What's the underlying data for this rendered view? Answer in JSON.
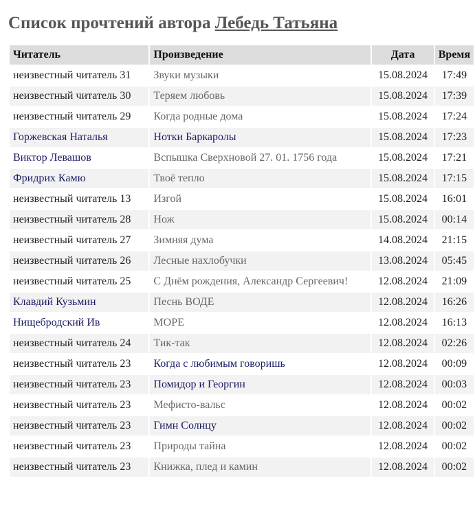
{
  "header": {
    "title_prefix": "Список прочтений автора",
    "author_name": "Лебедь Татьяна"
  },
  "table": {
    "columns": {
      "reader": "Читатель",
      "work": "Произведение",
      "date": "Дата",
      "time": "Время"
    },
    "rows": [
      {
        "reader": "неизвестный читатель 31",
        "reader_link": false,
        "work": "Звуки музыки",
        "work_link": false,
        "date": "15.08.2024",
        "time": "17:49"
      },
      {
        "reader": "неизвестный читатель 30",
        "reader_link": false,
        "work": "Теряем любовь",
        "work_link": false,
        "date": "15.08.2024",
        "time": "17:39"
      },
      {
        "reader": "неизвестный читатель 29",
        "reader_link": false,
        "work": "Когда родные дома",
        "work_link": false,
        "date": "15.08.2024",
        "time": "17:24"
      },
      {
        "reader": "Горжевская Наталья",
        "reader_link": true,
        "work": "Нотки Баркаролы",
        "work_link": true,
        "date": "15.08.2024",
        "time": "17:23"
      },
      {
        "reader": "Виктор Левашов",
        "reader_link": true,
        "work": "Вспышка Сверхновой 27. 01. 1756 года",
        "work_link": false,
        "date": "15.08.2024",
        "time": "17:21"
      },
      {
        "reader": "Фридрих Камю",
        "reader_link": true,
        "work": "Твоё тепло",
        "work_link": false,
        "date": "15.08.2024",
        "time": "17:15"
      },
      {
        "reader": "неизвестный читатель 13",
        "reader_link": false,
        "work": "Изгой",
        "work_link": false,
        "date": "15.08.2024",
        "time": "16:01"
      },
      {
        "reader": "неизвестный читатель 28",
        "reader_link": false,
        "work": "Нож",
        "work_link": false,
        "date": "15.08.2024",
        "time": "00:14"
      },
      {
        "reader": "неизвестный читатель 27",
        "reader_link": false,
        "work": "Зимняя дума",
        "work_link": false,
        "date": "14.08.2024",
        "time": "21:15"
      },
      {
        "reader": "неизвестный читатель 26",
        "reader_link": false,
        "work": "Лесные нахлобучки",
        "work_link": false,
        "date": "13.08.2024",
        "time": "05:45"
      },
      {
        "reader": "неизвестный читатель 25",
        "reader_link": false,
        "work": "С Днём рождения, Александр Сергеевич!",
        "work_link": false,
        "date": "12.08.2024",
        "time": "21:09"
      },
      {
        "reader": "Клавдий Кузьмин",
        "reader_link": true,
        "work": "Песнь ВОДЕ",
        "work_link": false,
        "date": "12.08.2024",
        "time": "16:26"
      },
      {
        "reader": "Нищебродский Ив",
        "reader_link": true,
        "work": "МОРЕ",
        "work_link": false,
        "date": "12.08.2024",
        "time": "16:13"
      },
      {
        "reader": "неизвестный читатель 24",
        "reader_link": false,
        "work": "Тик-так",
        "work_link": false,
        "date": "12.08.2024",
        "time": "02:26"
      },
      {
        "reader": "неизвестный читатель 23",
        "reader_link": false,
        "work": "Когда с любимым говоришь",
        "work_link": true,
        "date": "12.08.2024",
        "time": "00:09"
      },
      {
        "reader": "неизвестный читатель 23",
        "reader_link": false,
        "work": "Помидор и Георгин",
        "work_link": true,
        "date": "12.08.2024",
        "time": "00:03"
      },
      {
        "reader": "неизвестный читатель 23",
        "reader_link": false,
        "work": "Мефисто-вальс",
        "work_link": false,
        "date": "12.08.2024",
        "time": "00:02"
      },
      {
        "reader": "неизвестный читатель 23",
        "reader_link": false,
        "work": "Гимн Солнцу",
        "work_link": true,
        "date": "12.08.2024",
        "time": "00:02"
      },
      {
        "reader": "неизвестный читатель 23",
        "reader_link": false,
        "work": "Природы тайна",
        "work_link": false,
        "date": "12.08.2024",
        "time": "00:02"
      },
      {
        "reader": "неизвестный читатель 23",
        "reader_link": false,
        "work": "Книжка, плед и камин",
        "work_link": false,
        "date": "12.08.2024",
        "time": "00:02"
      }
    ]
  }
}
